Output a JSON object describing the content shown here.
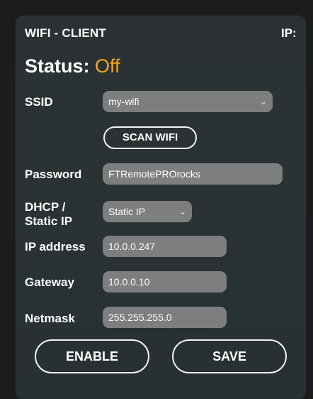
{
  "header": {
    "title": "WIFI - CLIENT",
    "ip_label": "IP:"
  },
  "status": {
    "label": "Status:",
    "value": "Off",
    "value_color": "#f2a81d"
  },
  "ssid": {
    "label": "SSID",
    "selected": "my-wifi"
  },
  "scan_button": {
    "label": "SCAN WIFI"
  },
  "password": {
    "label": "Password",
    "value": "FTRemotePROrocks"
  },
  "dhcp": {
    "label_line1": "DHCP /",
    "label_line2": "Static IP",
    "selected": "Static IP"
  },
  "ip_address": {
    "label": "IP address",
    "value": "10.0.0.247"
  },
  "gateway": {
    "label": "Gateway",
    "value": "10.0.0.10"
  },
  "netmask": {
    "label": "Netmask",
    "value": "255.255.255.0"
  },
  "actions": {
    "enable_label": "ENABLE",
    "save_label": "SAVE"
  },
  "icons": {
    "dropdown": "chevron-down-icon"
  }
}
